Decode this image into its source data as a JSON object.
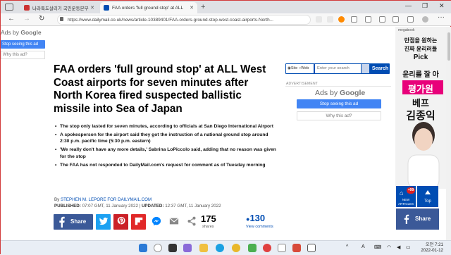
{
  "browser": {
    "tabs": [
      {
        "label": "나라독도살리기 국민운동본부",
        "active": false
      },
      {
        "label": "FAA orders 'full ground stop' at ALL",
        "active": true
      }
    ],
    "url": "https://www.dailymail.co.uk/news/article-10389401/FAA-orders-ground-stop-west-coast-airports-North..."
  },
  "left_ad": {
    "ads_by": "Ads by ",
    "google": "Google",
    "stop_label": "Stop seeing this ad",
    "why_label": "Why this ad?"
  },
  "article": {
    "headline": "FAA orders 'full ground stop' at ALL West Coast airports for seven minutes after North Korea fired suspected ballistic missile into Sea of Japan",
    "bullets": [
      "The stop only lasted for seven minutes, according to officials at San Diego International Airport",
      "A spokesperson for the airport said they got the instruction of a national ground stop around 2:30 p.m. pacific time (5:30 p.m. eastern)",
      "'We really don't have any more details,' Sabrina LoPiccolo said, adding that no reason was given for the stop",
      "The FAA has not responded to DailyMail.com's request for comment as of Tuesday morning"
    ],
    "by_prefix": "By",
    "author": "STEPHEN M. LEPORE FOR DAILYMAIL.COM",
    "published_label": "PUBLISHED:",
    "published": "07:07 GMT, 11 January 2022",
    "updated_label": "UPDATED:",
    "updated": "12:37 GMT, 11 January 2022"
  },
  "share": {
    "share_label": "Share",
    "share_count": "175",
    "shares_label": "shares",
    "comment_count": "130",
    "view_comments": "View comments"
  },
  "search": {
    "opt_site": "Site",
    "opt_web": "Web",
    "placeholder": "Enter your search",
    "button": "Search"
  },
  "right_ad": {
    "advertisement": "ADVERTISEMENT",
    "ads_by": "Ads by ",
    "google": "Google",
    "stop_label": "Stop seeing this ad",
    "why_label": "Why this ad?"
  },
  "kor_ad": {
    "brand": "megabook",
    "line_a": "만점을 원하는",
    "line_b": "진짜 윤리러들",
    "line_c": "Pick",
    "line_d": "윤리를 잘 아",
    "line_e": "평가원",
    "line_f": "베프",
    "line_g": "김종익"
  },
  "sticky": {
    "new_badge": "+99",
    "new_label": "NEW ARTICLES",
    "top_label": "Top",
    "fb_share": "Share"
  },
  "taskbar": {
    "ime": "A",
    "time": "오전 7:21",
    "date": "2022-01-12"
  },
  "colors": {
    "dm_blue": "#004db3",
    "facebook": "#3b5998",
    "google_blue": "#4285f4",
    "twitter": "#1da1f2",
    "pinterest": "#cb2027",
    "flipboard": "#e12828"
  }
}
